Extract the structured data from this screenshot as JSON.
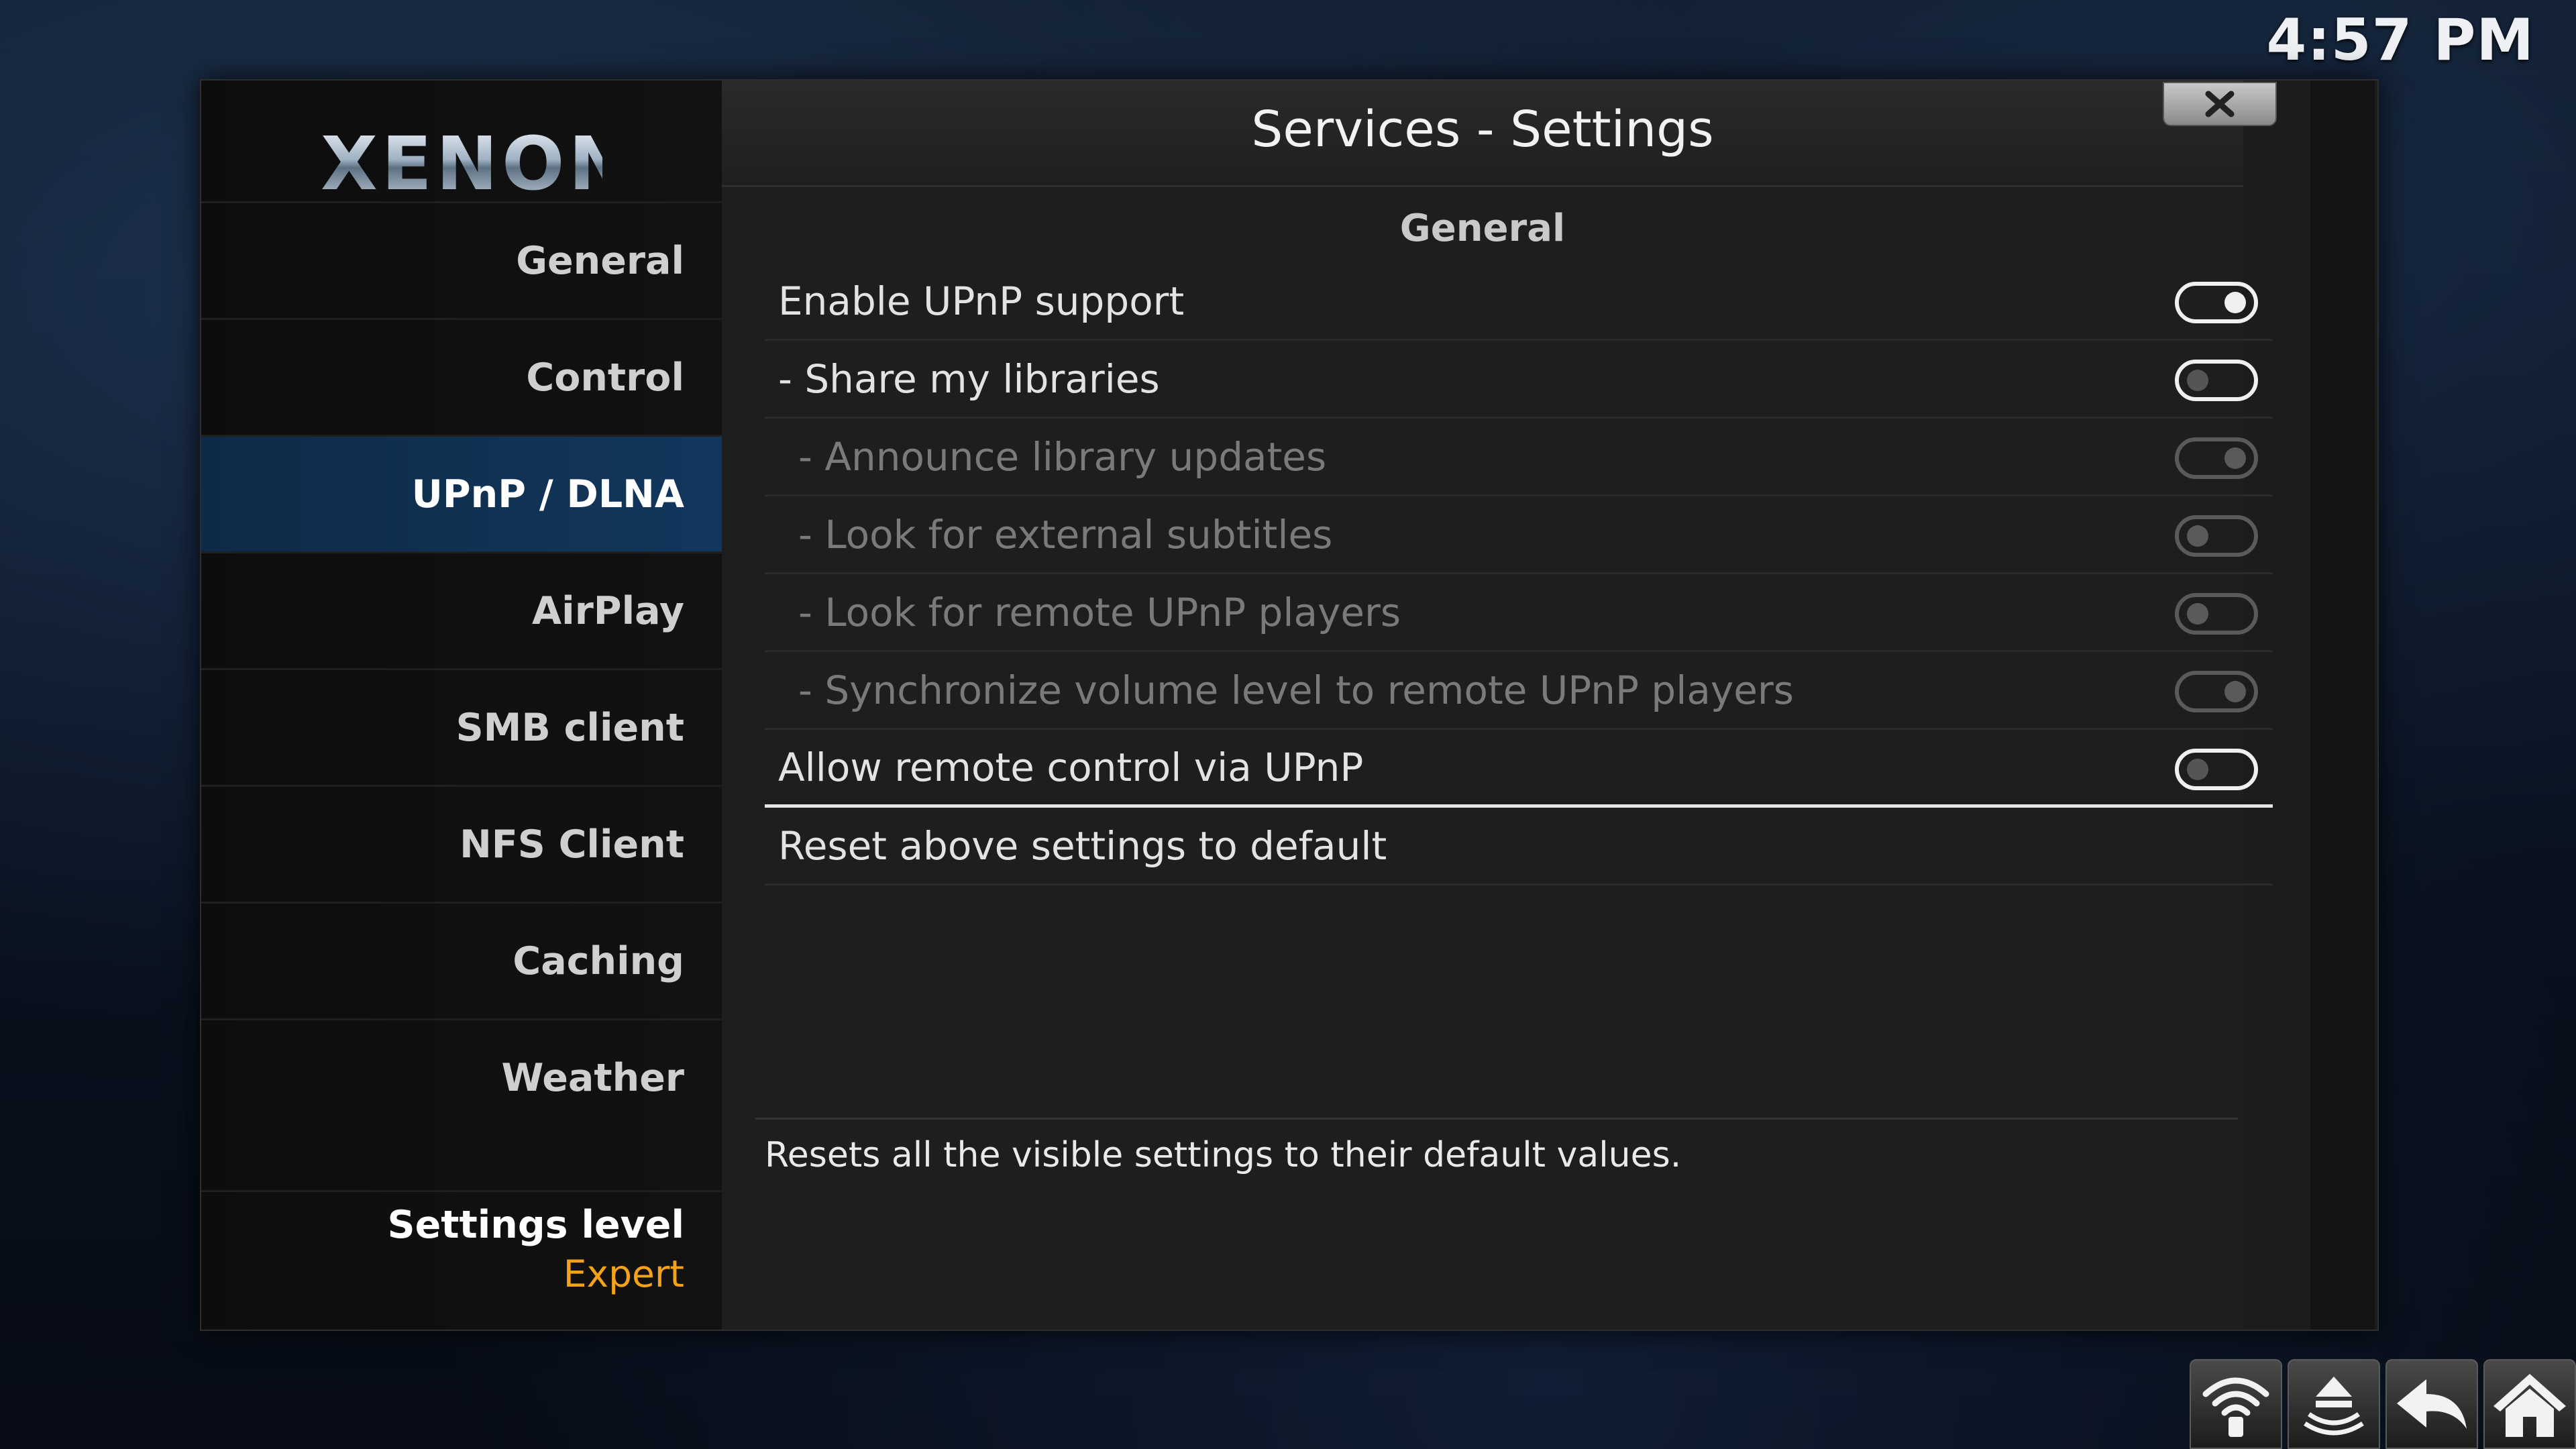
{
  "clock": "4:57 PM",
  "logo": "XENON",
  "window_title": "Services - Settings",
  "sidebar": {
    "items": [
      {
        "label": "General",
        "active": false
      },
      {
        "label": "Control",
        "active": false
      },
      {
        "label": "UPnP / DLNA",
        "active": true
      },
      {
        "label": "AirPlay",
        "active": false
      },
      {
        "label": "SMB client",
        "active": false
      },
      {
        "label": "NFS Client",
        "active": false
      },
      {
        "label": "Caching",
        "active": false
      },
      {
        "label": "Weather",
        "active": false
      }
    ],
    "settings_level_label": "Settings level",
    "settings_level_value": "Expert"
  },
  "section": "General",
  "settings": [
    {
      "label": "Enable UPnP support",
      "state": "on",
      "enabled": true
    },
    {
      "label": "- Share my libraries",
      "state": "off",
      "enabled": true
    },
    {
      "label": "- Announce library updates",
      "state": "on",
      "enabled": false
    },
    {
      "label": "- Look for external subtitles",
      "state": "off",
      "enabled": false
    },
    {
      "label": "- Look for remote UPnP players",
      "state": "off",
      "enabled": false
    },
    {
      "label": "- Synchronize volume level to remote UPnP players",
      "state": "on",
      "enabled": false
    },
    {
      "label": "Allow remote control via UPnP",
      "state": "off",
      "enabled": true
    }
  ],
  "reset_label": "Reset above settings to default",
  "description": "Resets all the visible settings to their default values.",
  "bottom_icons": [
    "wifi-network-icon",
    "eject-icon",
    "back-icon",
    "home-icon"
  ]
}
